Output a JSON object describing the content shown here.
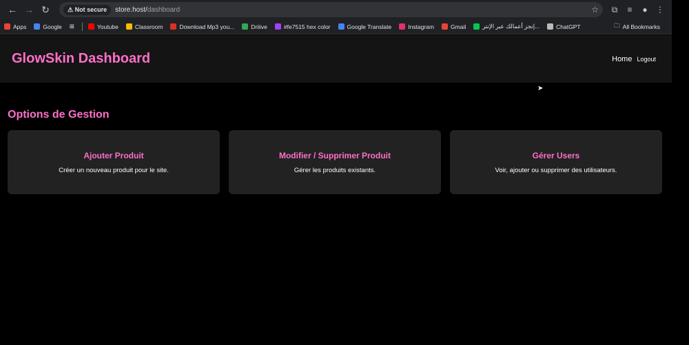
{
  "browser": {
    "not_secure": "Not secure",
    "url_host": "store.host/",
    "url_path": "dashboard"
  },
  "bookmarks": [
    "Apps",
    "Google",
    "Youtube",
    "Classroom",
    "Download Mp3 you...",
    "Driiive",
    "#fe7515 hex color",
    "Google Translate",
    "Instagram",
    "Gmail",
    "إنجز أعمالك عبر الإنتر...",
    "ChatGPT"
  ],
  "all_bookmarks": "All Bookmarks",
  "bookmark_colors": [
    "#ea4335",
    "#4285f4",
    "#ff0000",
    "#fbbc04",
    "#d93025",
    "#34a853",
    "#a142f4",
    "#4285f4",
    "#e1306c",
    "#ea4335",
    "#00c853",
    "#bbbbbb"
  ],
  "header": {
    "title": "GlowSkin Dashboard",
    "nav": {
      "home": "Home",
      "logout": "Logout"
    }
  },
  "main": {
    "section_title": "Options de Gestion",
    "cards": [
      {
        "title": "Ajouter Produit",
        "desc": "Créer un nouveau produit pour le site."
      },
      {
        "title": "Modifier / Supprimer Produit",
        "desc": "Gérer les produits existants."
      },
      {
        "title": "Gérer Users",
        "desc": "Voir, ajouter ou supprimer des utilisateurs."
      }
    ]
  },
  "colors": {
    "accent": "#ff6fc8",
    "card": "#222222",
    "header": "#141414"
  }
}
